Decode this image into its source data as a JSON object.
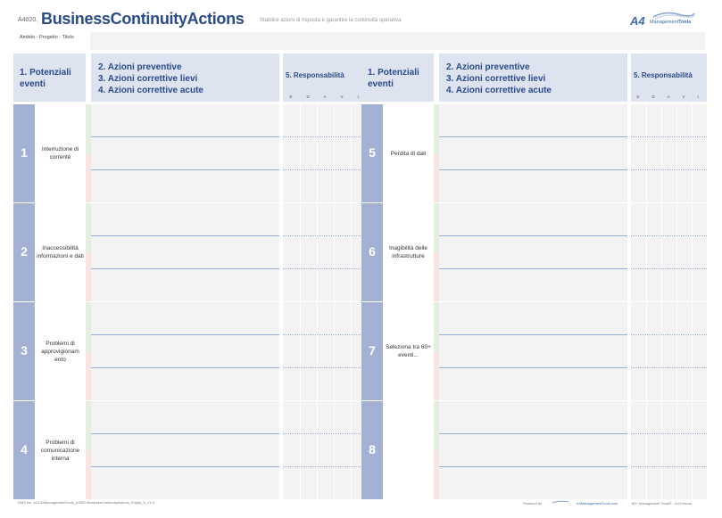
{
  "header": {
    "code": "A4020.",
    "title": "BusinessContinuityActions",
    "subtitle": "Stabilire azioni di risposta e garantire la continuità operativa",
    "logo_a4": "A4",
    "logo_management": "Management",
    "logo_tools": "Tools"
  },
  "ambito": {
    "label": "Ambito - Progetto - Titolo"
  },
  "columns": {
    "events": "1. Potenziali eventi",
    "actions_1": "2. Azioni preventive",
    "actions_2": "3. Azioni correttive lievi",
    "actions_3": "4. Azioni correttive acute",
    "responsibility": "5. Responsabilità",
    "raci": [
      "E",
      "D",
      "A",
      "V",
      "I"
    ]
  },
  "events_left": [
    {
      "num": "1",
      "label": "Interruzione di corrente"
    },
    {
      "num": "2",
      "label": "Inaccessibilità informazioni e dati"
    },
    {
      "num": "3",
      "label": "Problemi di approvigionam ento"
    },
    {
      "num": "4",
      "label": "Problemi di comunicazione interna"
    }
  ],
  "events_right": [
    {
      "num": "5",
      "label": "Perdita di dati"
    },
    {
      "num": "6",
      "label": "Inagibilità delle infrastrutture"
    },
    {
      "num": "7",
      "label": "Seleziona tra 60+ eventi..."
    },
    {
      "num": "8",
      "label": ""
    }
  ],
  "footer": {
    "left": "DMS No. 410.A4ManagementTools_A4020.BusinessContinuityActions_Empty_It_V1.0",
    "powered": "Powered by",
    "site": "A4ManagementTools.com",
    "right": "80+ Management Tools® - A4-Format"
  },
  "colors": {
    "title": "#2a4a8a",
    "header_bg": "#dde3ef",
    "number_col": "#a3b2d4",
    "field_bg": "#f3f3f3",
    "line": "#9aaed0"
  }
}
